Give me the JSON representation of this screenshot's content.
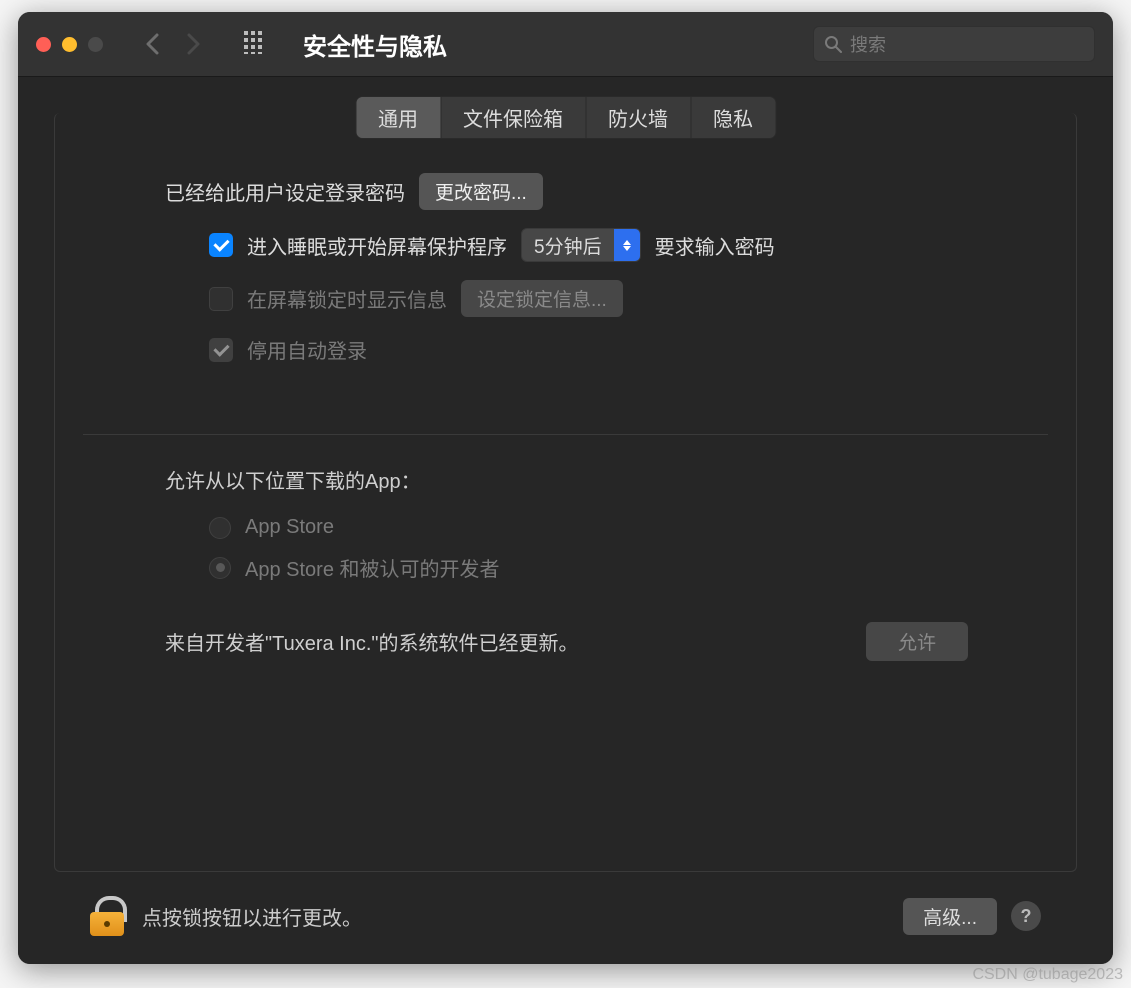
{
  "window": {
    "title": "安全性与隐私"
  },
  "search": {
    "placeholder": "搜索"
  },
  "tabs": [
    {
      "label": "通用",
      "active": true
    },
    {
      "label": "文件保险箱",
      "active": false
    },
    {
      "label": "防火墙",
      "active": false
    },
    {
      "label": "隐私",
      "active": false
    }
  ],
  "general": {
    "password_set_label": "已经给此用户设定登录密码",
    "change_password_button": "更改密码...",
    "require_password_checkbox": {
      "checked": true,
      "label_before": "进入睡眠或开始屏幕保护程序"
    },
    "require_password_delay": "5分钟后",
    "require_password_after": "要求输入密码",
    "show_lock_message": {
      "checked": false,
      "label": "在屏幕锁定时显示信息"
    },
    "set_lock_message_button": "设定锁定信息...",
    "disable_auto_login": {
      "checked": true,
      "label": "停用自动登录"
    }
  },
  "download": {
    "title": "允许从以下位置下载的App：",
    "options": [
      {
        "label": "App Store",
        "selected": false
      },
      {
        "label": "App Store 和被认可的开发者",
        "selected": true
      }
    ],
    "developer_notice": "来自开发者\"Tuxera Inc.\"的系统软件已经更新。",
    "allow_button": "允许"
  },
  "footer": {
    "lock_text": "点按锁按钮以进行更改。",
    "advanced_button": "高级...",
    "help": "?"
  },
  "watermark": "CSDN @tubage2023"
}
